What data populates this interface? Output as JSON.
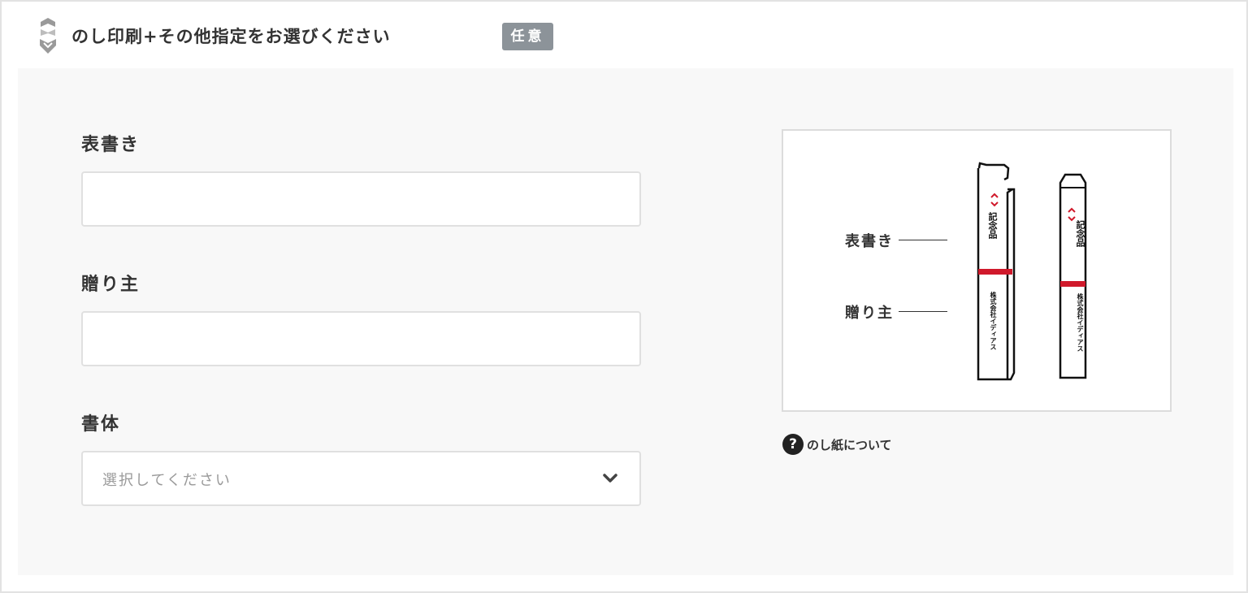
{
  "header": {
    "title": "のし印刷+その他指定をお選びください",
    "badge": "任意",
    "icon": "noshi-logo-icon"
  },
  "form": {
    "omotegaki": {
      "label": "表書き",
      "value": "",
      "placeholder": ""
    },
    "okurinushi": {
      "label": "贈り主",
      "value": "",
      "placeholder": ""
    },
    "shotai": {
      "label": "書体",
      "selected": "選択してください"
    }
  },
  "illustration": {
    "label_omotegaki": "表書き",
    "label_okurinushi": "贈り主",
    "box_text_top": "記念品",
    "box_text_bottom": "株式会社イディアス",
    "colors": {
      "accent_red": "#d0192b",
      "outline": "#111111"
    }
  },
  "help": {
    "icon": "question-circle-icon",
    "icon_glyph": "?",
    "label": "のし紙について"
  },
  "colors": {
    "panel_bg": "#f8f8f8",
    "badge_bg": "#8c9399",
    "border": "#e0e0e0"
  }
}
